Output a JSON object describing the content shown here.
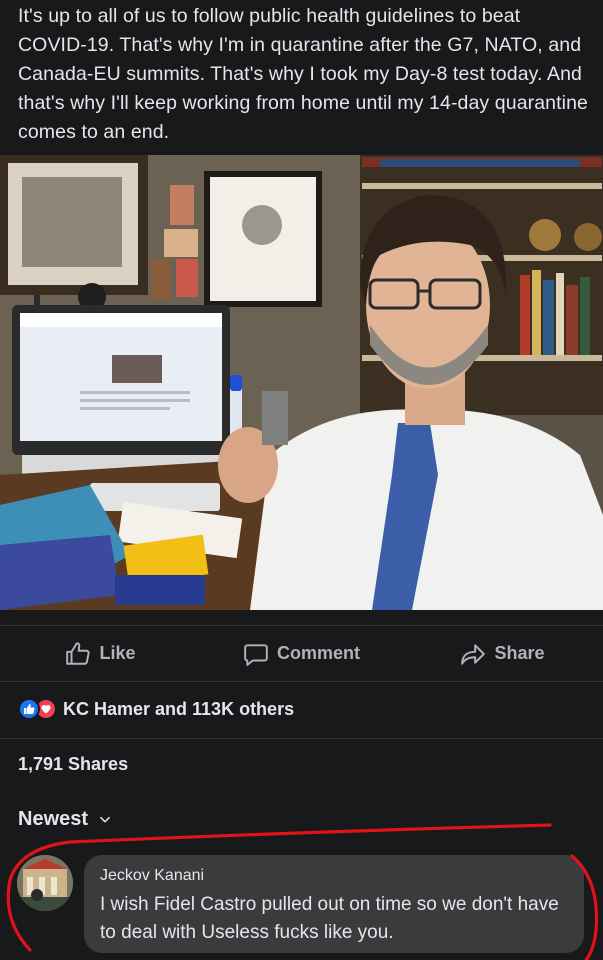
{
  "post": {
    "text": "It's up to all of us to follow public health guidelines to beat COVID-19. That's why I'm in quarantine after the G7, NATO, and Canada-EU summits. That's why I took my Day-8 test today. And that's why I'll keep working from home until my 14-day quarantine comes to an end."
  },
  "actions": {
    "like": "Like",
    "comment": "Comment",
    "share": "Share"
  },
  "reactions": {
    "summary": "KC Hamer and 113K others"
  },
  "shares": {
    "count_text": "1,791 Shares"
  },
  "comments_sort": {
    "label": "Newest"
  },
  "comment": {
    "author": "Jeckov Kanani",
    "text": "I wish Fidel Castro pulled out on time so we don't have to deal with Useless fucks like you."
  },
  "colors": {
    "background": "#18191a",
    "bubble": "#3a3b3c",
    "like_blue": "#1877f2",
    "love_red": "#f33e58",
    "annotation_red": "#e0131b"
  }
}
